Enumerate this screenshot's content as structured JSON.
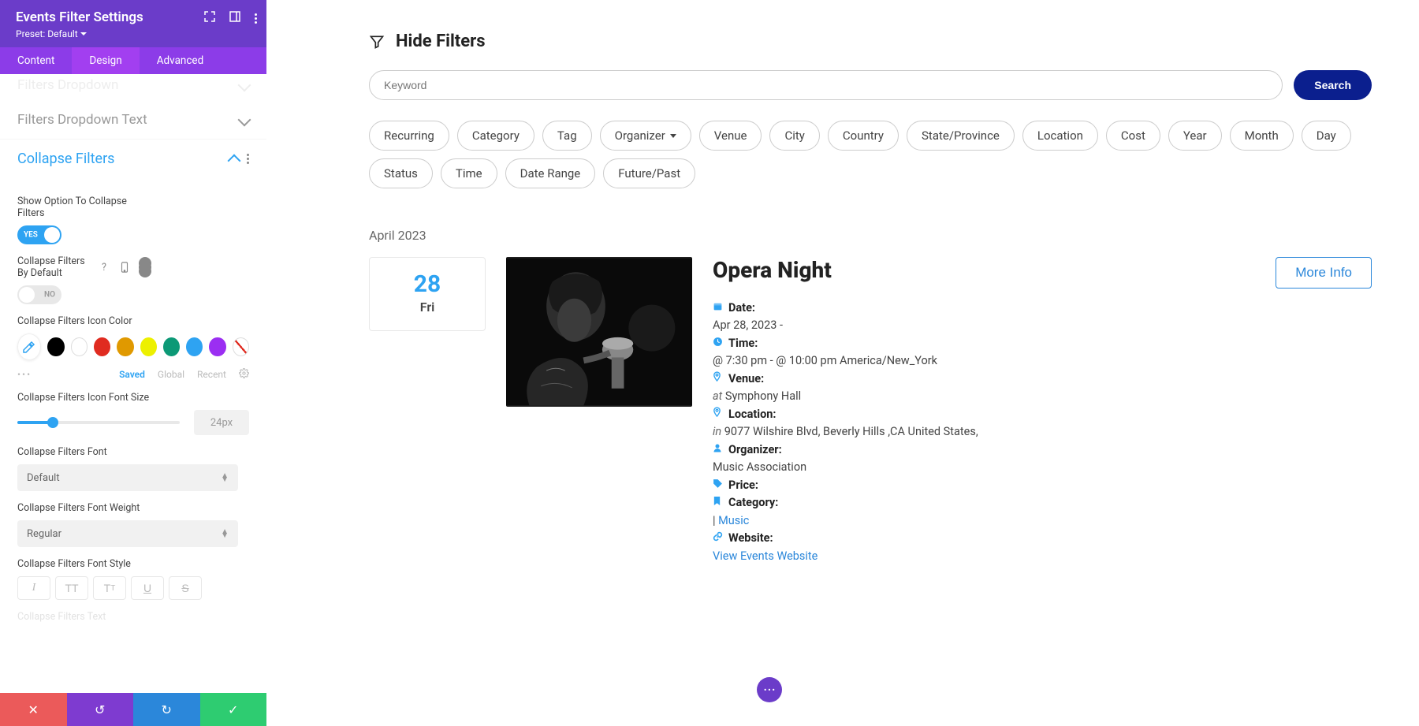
{
  "sidebar": {
    "title": "Events Filter Settings",
    "preset": "Preset: Default",
    "tabs": {
      "content": "Content",
      "design": "Design",
      "advanced": "Advanced"
    },
    "sections": {
      "filters_dropdown": "Filters Dropdown",
      "filters_dropdown_text": "Filters Dropdown Text",
      "collapse_filters": "Collapse Filters"
    },
    "opts": {
      "show_option": "Show Option To Collapse Filters",
      "yes": "YES",
      "collapse_default": "Collapse Filters By Default",
      "no": "NO",
      "icon_color": "Collapse Filters Icon Color",
      "saved": "Saved",
      "global": "Global",
      "recent": "Recent",
      "icon_font_size": "Collapse Filters Icon Font Size",
      "icon_font_size_val": "24px",
      "font": "Collapse Filters Font",
      "font_val": "Default",
      "font_weight": "Collapse Filters Font Weight",
      "font_weight_val": "Regular",
      "font_style": "Collapse Filters Font Style",
      "next_cut": "Collapse Filters Text"
    }
  },
  "main": {
    "hide_filters": "Hide Filters",
    "keyword_placeholder": "Keyword",
    "search": "Search",
    "pills": [
      "Recurring",
      "Category",
      "Tag",
      "Organizer",
      "Venue",
      "City",
      "Country",
      "State/Province",
      "Location",
      "Cost",
      "Year",
      "Month",
      "Day",
      "Status",
      "Time",
      "Date Range",
      "Future/Past"
    ],
    "month": "April 2023",
    "date_num": "28",
    "date_day": "Fri",
    "event_title": "Opera Night",
    "more_info": "More Info",
    "labels": {
      "date": "Date:",
      "time": "Time:",
      "venue": "Venue:",
      "location": "Location:",
      "organizer": "Organizer:",
      "price": "Price:",
      "category": "Category:",
      "website": "Website:"
    },
    "vals": {
      "date": "Apr 28, 2023 -",
      "time": "@ 7:30 pm - @ 10:00 pm America/New_York",
      "venue_pre": "at ",
      "venue": "Symphony Hall",
      "loc_pre": "in ",
      "loc": "9077 Wilshire Blvd, Beverly Hills ,CA United States,",
      "organizer": "Music Association",
      "cat_pre": "| ",
      "cat": "Music",
      "website": "View Events Website"
    }
  }
}
